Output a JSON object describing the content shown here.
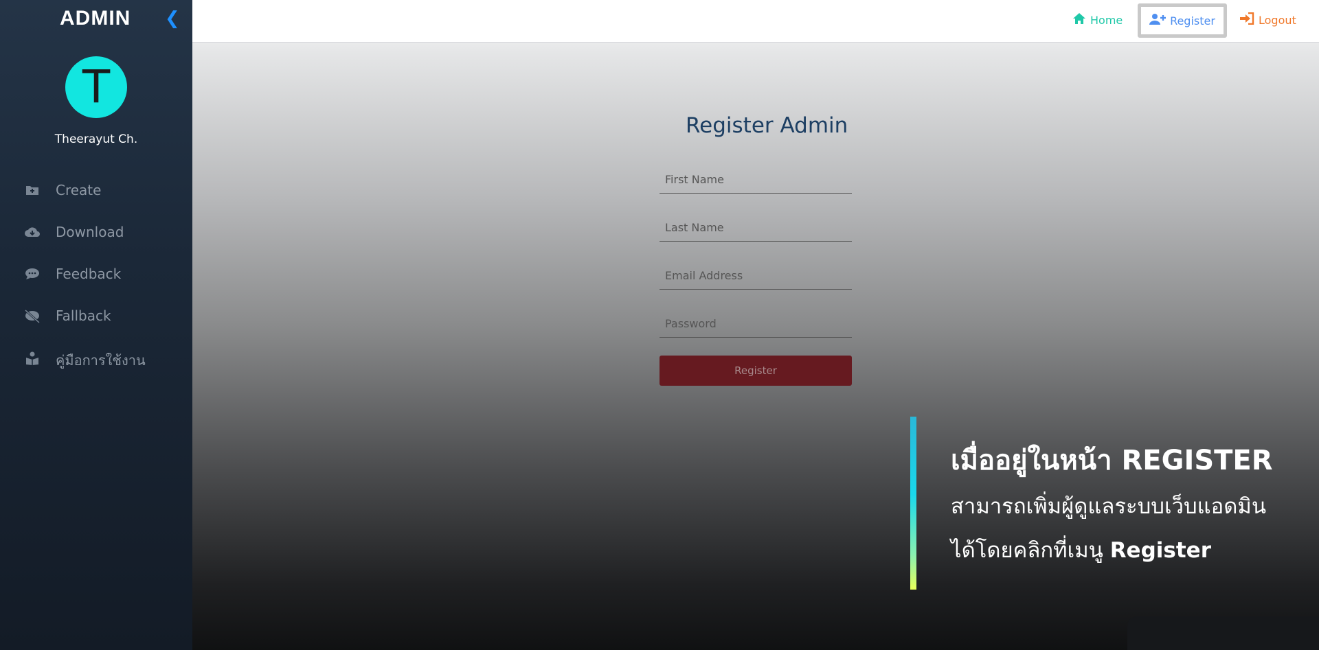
{
  "sidebar": {
    "brand": "ADMIN",
    "collapse_icon": "❮",
    "avatar_letter": "T",
    "username": "Theerayut Ch.",
    "items": [
      {
        "label": "Create",
        "icon": "folder-plus-icon"
      },
      {
        "label": "Download",
        "icon": "cloud-download-icon"
      },
      {
        "label": "Feedback",
        "icon": "comment-icon"
      },
      {
        "label": "Fallback",
        "icon": "comment-slash-icon"
      },
      {
        "label": "คู่มือการใช้งาน",
        "icon": "book-reader-icon"
      }
    ]
  },
  "topbar": {
    "home": "Home",
    "register": "Register",
    "logout": "Logout"
  },
  "form": {
    "title": "Register Admin",
    "first_name_placeholder": "First Name",
    "last_name_placeholder": "Last Name",
    "email_placeholder": "Email Address",
    "password_placeholder": "Password",
    "submit": "Register"
  },
  "callout": {
    "title": "เมื่ออยู่ในหน้า REGISTER",
    "line1": "สามารถเพิ่มผู้ดูแลระบบเว็บแอดมิน",
    "line2_prefix": "ได้โดยคลิกที่เมนู ",
    "line2_bold": "Register"
  },
  "colors": {
    "accent_home": "#1fc8a8",
    "accent_register": "#4f8ff0",
    "accent_logout": "#f0782a",
    "avatar_bg": "#12e6e0",
    "submit_bg": "#661a20"
  }
}
